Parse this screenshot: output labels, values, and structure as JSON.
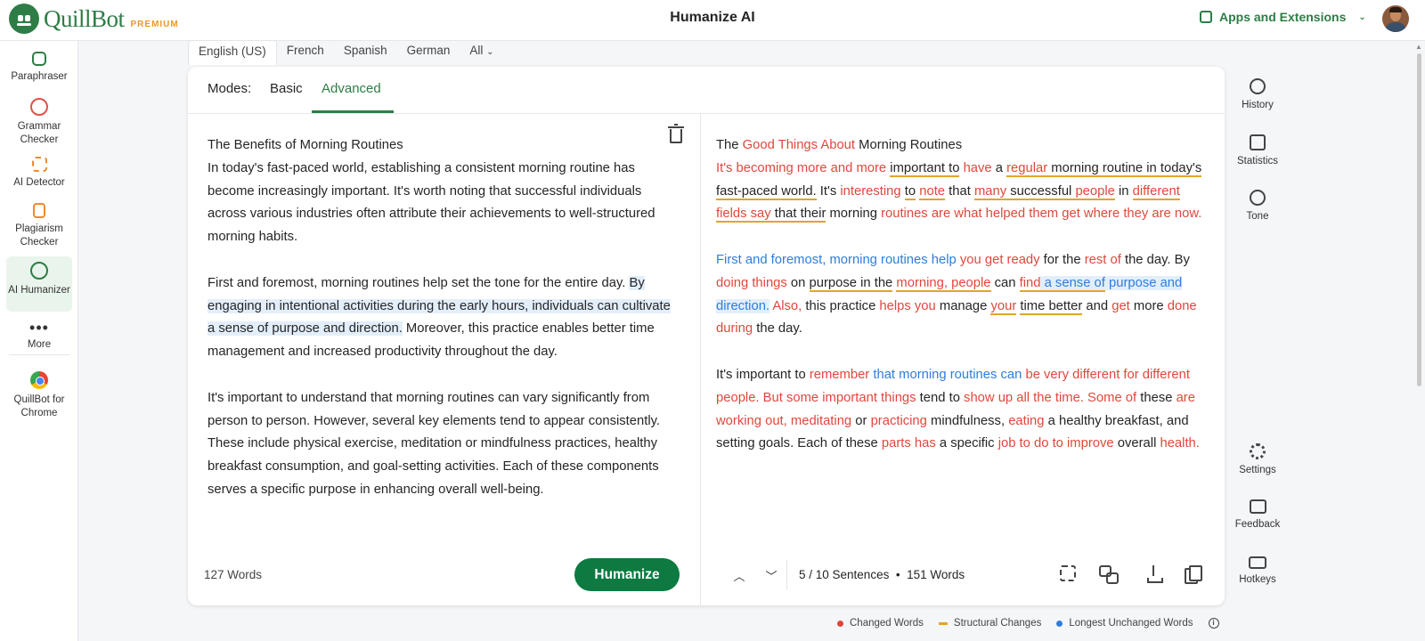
{
  "header": {
    "brand": "QuillBot",
    "badge": "PREMIUM",
    "title": "Humanize AI",
    "apps_label": "Apps and Extensions",
    "brand_color": "#2e7d46"
  },
  "sidebar": {
    "items": [
      {
        "label": "Paraphraser",
        "icon": "paraphraser-icon"
      },
      {
        "label": "Grammar Checker",
        "icon": "grammar-checker-icon"
      },
      {
        "label": "AI Detector",
        "icon": "ai-detector-icon"
      },
      {
        "label": "Plagiarism Checker",
        "icon": "plagiarism-checker-icon"
      },
      {
        "label": "AI Humanizer",
        "icon": "ai-humanizer-icon"
      },
      {
        "label": "More",
        "icon": "more-icon"
      },
      {
        "label": "QuillBot for Chrome",
        "icon": "chrome-icon"
      }
    ]
  },
  "languages": [
    "English (US)",
    "French",
    "Spanish",
    "German",
    "All"
  ],
  "modes": {
    "label": "Modes:",
    "options": [
      "Basic",
      "Advanced"
    ],
    "selected": "Advanced"
  },
  "input": {
    "title": "The Benefits of Morning Routines",
    "p1": "In today's fast-paced world, establishing a consistent morning routine has become increasingly important. It's worth noting that successful individuals across various industries often attribute their achievements to well-structured morning habits.",
    "p2_a": "First and foremost, morning routines help set the tone for the entire day. ",
    "p2_hl": "By engaging in intentional activities during the early hours, individuals can cultivate a sense of purpose and direction.",
    "p2_b": " Moreover, this practice enables better time management and increased productivity throughout the day.",
    "p3": "It's important to understand that morning routines can vary significantly from person to person. However, several key elements tend to appear consistently. These include physical exercise, meditation or mindfulness practices, healthy breakfast consumption, and goal-setting activities. Each of these components serves a specific purpose in enhancing overall well-being.",
    "word_count": "127 Words",
    "button": "Humanize"
  },
  "output": {
    "title_1": "The ",
    "title_2": "Good Things About",
    "title_3": " Morning Routines",
    "p1": [
      {
        "t": "It's becoming more and more",
        "k": "c"
      },
      {
        "t": " ",
        "k": ""
      },
      {
        "t": "important",
        "k": "s"
      },
      {
        "t": " ",
        "k": "s"
      },
      {
        "t": "to",
        "k": "s"
      },
      {
        "t": " ",
        "k": ""
      },
      {
        "t": "have",
        "k": "c"
      },
      {
        "t": " a ",
        "k": ""
      },
      {
        "t": "regular",
        "k": "sc"
      },
      {
        "t": " morning routine in today's fast-paced world.",
        "k": "s"
      },
      {
        "t": " It's ",
        "k": ""
      },
      {
        "t": "interesting",
        "k": "c"
      },
      {
        "t": " ",
        "k": ""
      },
      {
        "t": "to",
        "k": "s"
      },
      {
        "t": " ",
        "k": ""
      },
      {
        "t": "note",
        "k": "sc"
      },
      {
        "t": " that ",
        "k": ""
      },
      {
        "t": "many",
        "k": "sc"
      },
      {
        "t": " successful ",
        "k": "s"
      },
      {
        "t": "people",
        "k": "sc"
      },
      {
        "t": " in ",
        "k": ""
      },
      {
        "t": "different fields say",
        "k": "sc"
      },
      {
        "t": " that their",
        "k": "s"
      },
      {
        "t": " morning ",
        "k": ""
      },
      {
        "t": "routines are what helped them get where they are now.",
        "k": "c"
      }
    ],
    "p2": [
      {
        "t": "First and foremost, morning routines help",
        "k": "b"
      },
      {
        "t": " ",
        "k": ""
      },
      {
        "t": "you get ready",
        "k": "c"
      },
      {
        "t": " for the ",
        "k": ""
      },
      {
        "t": "rest of",
        "k": "c"
      },
      {
        "t": " the day. By ",
        "k": ""
      },
      {
        "t": "doing things",
        "k": "c"
      },
      {
        "t": " on ",
        "k": ""
      },
      {
        "t": "purpose in the",
        "k": "s"
      },
      {
        "t": " ",
        "k": ""
      },
      {
        "t": "morning, people",
        "k": "sc"
      },
      {
        "t": " can ",
        "k": ""
      },
      {
        "t": "find",
        "k": "sc"
      },
      {
        "t": " a sense of",
        "k": "shb"
      },
      {
        "t": " purpose and direction.",
        "k": "hb"
      },
      {
        "t": " ",
        "k": ""
      },
      {
        "t": "Also,",
        "k": "c"
      },
      {
        "t": " this practice ",
        "k": ""
      },
      {
        "t": "helps you",
        "k": "c"
      },
      {
        "t": " manage ",
        "k": ""
      },
      {
        "t": "your",
        "k": "sc"
      },
      {
        "t": " ",
        "k": ""
      },
      {
        "t": "time better",
        "k": "s"
      },
      {
        "t": " and ",
        "k": ""
      },
      {
        "t": "get",
        "k": "c"
      },
      {
        "t": " more ",
        "k": ""
      },
      {
        "t": "done during",
        "k": "c"
      },
      {
        "t": " the day.",
        "k": ""
      }
    ],
    "p3": [
      {
        "t": "It's important to ",
        "k": ""
      },
      {
        "t": "remember",
        "k": "c"
      },
      {
        "t": " that morning routines can",
        "k": "b"
      },
      {
        "t": " ",
        "k": ""
      },
      {
        "t": "be very different for different people. But some important things",
        "k": "c"
      },
      {
        "t": " tend to ",
        "k": ""
      },
      {
        "t": "show up all the time. Some of",
        "k": "c"
      },
      {
        "t": " these ",
        "k": ""
      },
      {
        "t": "are working out, meditating",
        "k": "c"
      },
      {
        "t": " or ",
        "k": ""
      },
      {
        "t": "practicing",
        "k": "c"
      },
      {
        "t": " mindfulness, ",
        "k": ""
      },
      {
        "t": "eating",
        "k": "c"
      },
      {
        "t": " a healthy breakfast, and setting goals. Each of these ",
        "k": ""
      },
      {
        "t": "parts has",
        "k": "c"
      },
      {
        "t": " a specific ",
        "k": ""
      },
      {
        "t": "job to do to improve",
        "k": "c"
      },
      {
        "t": " overall ",
        "k": ""
      },
      {
        "t": "health.",
        "k": "c"
      }
    ],
    "sentence_nav": "5 / 10 Sentences",
    "bullet": "•",
    "word_count": "151 Words"
  },
  "rail": {
    "history": "History",
    "statistics": "Statistics",
    "tone": "Tone",
    "settings": "Settings",
    "feedback": "Feedback",
    "hotkeys": "Hotkeys"
  },
  "legend": {
    "changed": "Changed Words",
    "structural": "Structural Changes",
    "unchanged": "Longest Unchanged Words",
    "changed_color": "#e0473c",
    "structural_color": "#e0a52a",
    "unchanged_color": "#2f7ddb"
  }
}
